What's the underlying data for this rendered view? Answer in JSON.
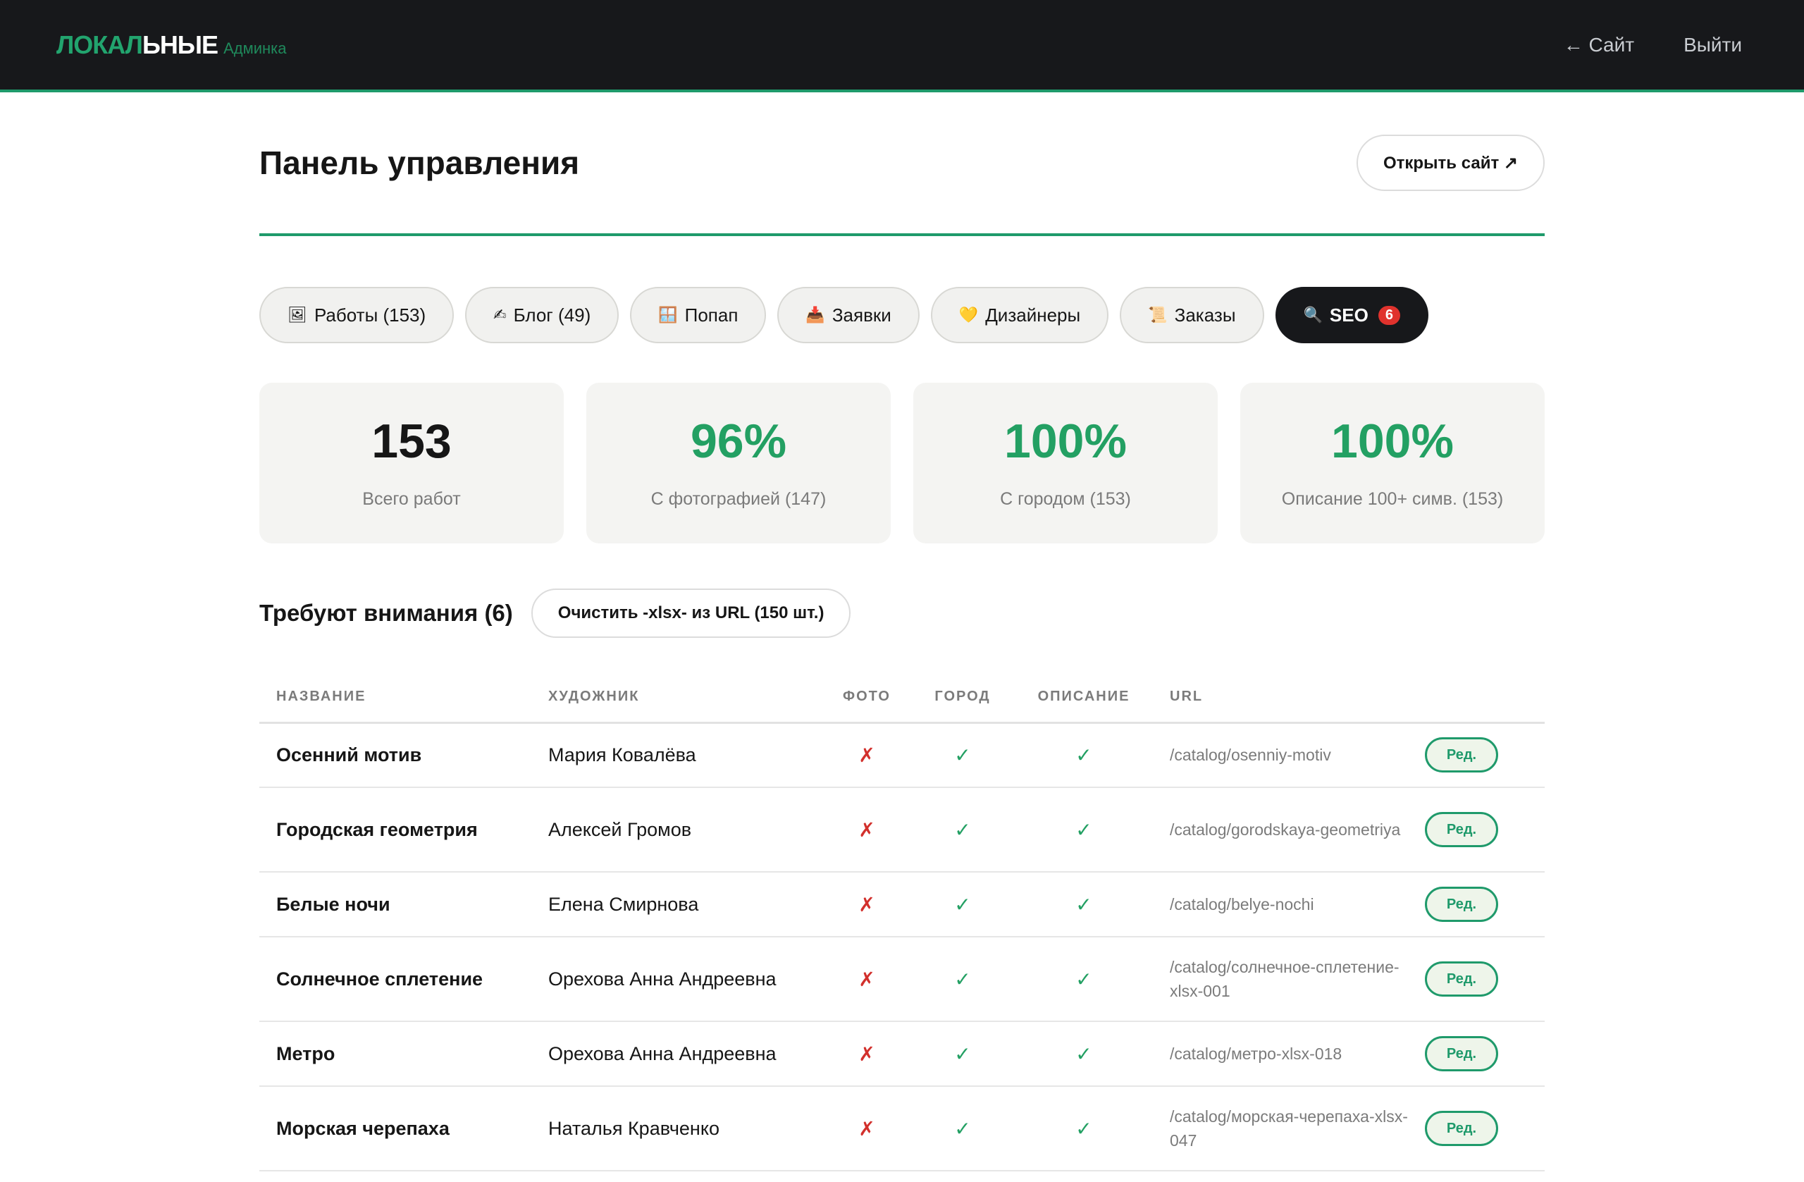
{
  "header": {
    "brand_part1": "ЛОКАЛ",
    "brand_part2": "ЬНЫЕ",
    "brand_sub": "Админка",
    "nav_site": "← Сайт",
    "nav_logout": "Выйти"
  },
  "page": {
    "title": "Панель управления",
    "open_site": "Открыть сайт ↗"
  },
  "tabs": [
    {
      "icon": "🖼",
      "label": "Работы (153)"
    },
    {
      "icon": "✍",
      "label": "Блог (49)"
    },
    {
      "icon": "🪟",
      "label": "Попап"
    },
    {
      "icon": "📥",
      "label": "Заявки"
    },
    {
      "icon": "💛",
      "label": "Дизайнеры"
    },
    {
      "icon": "📜",
      "label": "Заказы"
    },
    {
      "icon": "🔍",
      "label": "SEO",
      "badge": "6"
    }
  ],
  "stats": [
    {
      "value": "153",
      "label": "Всего работ"
    },
    {
      "value": "96%",
      "label": "С фотографией (147)"
    },
    {
      "value": "100%",
      "label": "С городом (153)"
    },
    {
      "value": "100%",
      "label": "Описание 100+ симв. (153)"
    }
  ],
  "attention": {
    "title": "Требуют внимания (6)",
    "clean_button": "Очистить -xlsx- из URL (150 шт.)"
  },
  "table": {
    "headers": [
      "НАЗВАНИЕ",
      "ХУДОЖНИК",
      "ФОТО",
      "ГОРОД",
      "ОПИСАНИЕ",
      "URL"
    ],
    "edit_label": "Ред.",
    "rows": [
      {
        "name": "Осенний мотив",
        "artist": "Мария Ковалёва",
        "photo": "✗",
        "city": "✓",
        "desc": "✓",
        "url": "/catalog/osenniy-motiv"
      },
      {
        "name": "Городская геометрия",
        "artist": "Алексей Громов",
        "photo": "✗",
        "city": "✓",
        "desc": "✓",
        "url": "/catalog/gorodskaya-geometriya"
      },
      {
        "name": "Белые ночи",
        "artist": "Елена Смирнова",
        "photo": "✗",
        "city": "✓",
        "desc": "✓",
        "url": "/catalog/belye-nochi"
      },
      {
        "name": "Солнечное сплетение",
        "artist": "Орехова Анна Андреевна",
        "photo": "✗",
        "city": "✓",
        "desc": "✓",
        "url": "/catalog/солнечное-сплетение-xlsx-001"
      },
      {
        "name": "Метро",
        "artist": "Орехова Анна Андреевна",
        "photo": "✗",
        "city": "✓",
        "desc": "✓",
        "url": "/catalog/метро-xlsx-018"
      },
      {
        "name": "Морская черепаха",
        "artist": "Наталья Кравченко",
        "photo": "✗",
        "city": "✓",
        "desc": "✓",
        "url": "/catalog/морская-черепаха-xlsx-047"
      }
    ]
  }
}
